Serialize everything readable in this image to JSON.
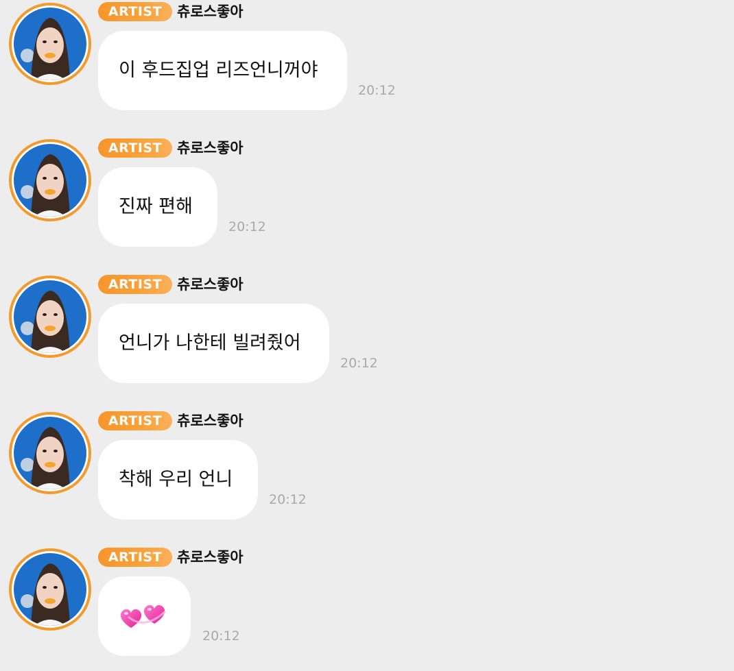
{
  "messages": [
    {
      "badge": "ARTIST",
      "sender": "츄로스좋아",
      "text": "이 후드집업 리즈언니꺼야",
      "time": "20:12",
      "avatar_icon": "profile-photo"
    },
    {
      "badge": "ARTIST",
      "sender": "츄로스좋아",
      "text": "진짜 편해",
      "time": "20:12",
      "avatar_icon": "profile-photo"
    },
    {
      "badge": "ARTIST",
      "sender": "츄로스좋아",
      "text": "언니가 나한테 빌려줬어",
      "time": "20:12",
      "avatar_icon": "profile-photo"
    },
    {
      "badge": "ARTIST",
      "sender": "츄로스좋아",
      "text": "착해 우리 언니",
      "time": "20:12",
      "avatar_icon": "profile-photo"
    },
    {
      "badge": "ARTIST",
      "sender": "츄로스좋아",
      "text": "",
      "emoji": "two-hearts-icon",
      "time": "20:12",
      "avatar_icon": "profile-photo"
    }
  ],
  "colors": {
    "background": "#ededed",
    "badge": "#f7952b",
    "avatar_ring": "#f39a2e",
    "bubble": "#ffffff",
    "time": "#a9a9a9"
  }
}
